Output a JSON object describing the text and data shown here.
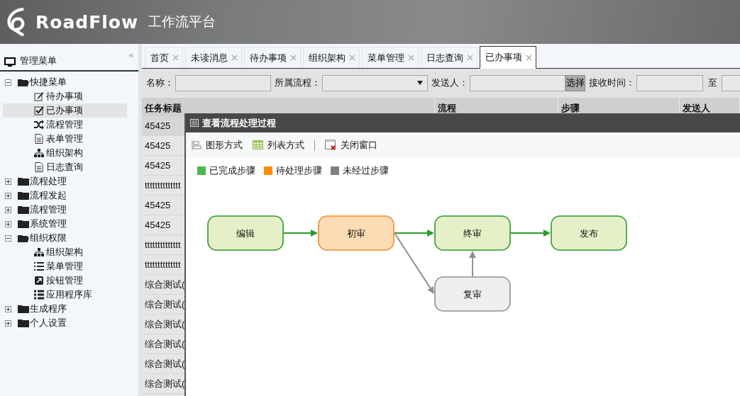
{
  "header": {
    "brand": "RoadFlow",
    "subtitle": "工作流平台"
  },
  "sidebar": {
    "title": "管理菜单",
    "collapse": "«",
    "items": [
      {
        "label": "快捷菜单",
        "expanded": true,
        "children": [
          {
            "label": "待办事项",
            "selected": false
          },
          {
            "label": "已办事项",
            "selected": true
          },
          {
            "label": "流程管理",
            "selected": false
          },
          {
            "label": "表单管理",
            "selected": false
          },
          {
            "label": "组织架构",
            "selected": false
          },
          {
            "label": "日志查询",
            "selected": false
          }
        ]
      },
      {
        "label": "流程处理",
        "expanded": false
      },
      {
        "label": "流程发起",
        "expanded": false
      },
      {
        "label": "流程管理",
        "expanded": false
      },
      {
        "label": "系统管理",
        "expanded": false
      },
      {
        "label": "组织权限",
        "expanded": true,
        "children": [
          {
            "label": "组织架构",
            "selected": false
          },
          {
            "label": "菜单管理",
            "selected": false
          },
          {
            "label": "按钮管理",
            "selected": false
          },
          {
            "label": "应用程序库",
            "selected": false
          }
        ]
      },
      {
        "label": "生成程序",
        "expanded": false
      },
      {
        "label": "个人设置",
        "expanded": false
      }
    ]
  },
  "tabs": [
    {
      "label": "首页",
      "selected": false
    },
    {
      "label": "未读消息",
      "selected": false
    },
    {
      "label": "待办事项",
      "selected": false
    },
    {
      "label": "组织架构",
      "selected": false
    },
    {
      "label": "菜单管理",
      "selected": false
    },
    {
      "label": "日志查询",
      "selected": false
    },
    {
      "label": "已办事项",
      "selected": true
    }
  ],
  "filters": [
    {
      "label": "名称：",
      "kind": "text"
    },
    {
      "label": "所属流程：",
      "kind": "select"
    },
    {
      "label": "发送人：",
      "kind": "picker",
      "button": "选择"
    },
    {
      "label": "接收时间：",
      "kind": "date"
    },
    {
      "label": "至",
      "kind": "date"
    }
  ],
  "table": {
    "columns": [
      "任务标题",
      "流程",
      "步骤",
      "发送人"
    ],
    "rows": [
      {
        "title": "45425",
        "selected": true
      },
      {
        "title": "45425",
        "selected": false
      },
      {
        "title": "45425",
        "selected": false
      },
      {
        "title": "tttttttttttttt",
        "selected": false
      },
      {
        "title": "45425",
        "selected": false
      },
      {
        "title": "45425",
        "selected": false
      },
      {
        "title": "tttttttttttttt",
        "selected": false
      },
      {
        "title": "tttttttttttttt",
        "selected": false
      },
      {
        "title": "综合测试(",
        "selected": false
      },
      {
        "title": "综合测试(",
        "selected": false
      },
      {
        "title": "综合测试(",
        "selected": false
      },
      {
        "title": "综合测试(",
        "selected": false
      },
      {
        "title": "综合测试(",
        "selected": false
      },
      {
        "title": "综合测试(",
        "selected": false
      }
    ]
  },
  "dialog": {
    "title": "查看流程处理过程",
    "toolbar": [
      {
        "label": "图形方式",
        "kind": "graph"
      },
      {
        "label": "列表方式",
        "kind": "list"
      },
      {
        "label": "关闭窗口",
        "kind": "close"
      }
    ],
    "legend": [
      {
        "label": "已完成步骤",
        "color": "#4cb84c"
      },
      {
        "label": "待处理步骤",
        "color": "#ff8c00"
      },
      {
        "label": "未经过步骤",
        "color": "#808080"
      }
    ],
    "nodes": [
      {
        "label": "编辑",
        "kind": "done"
      },
      {
        "label": "初审",
        "kind": "pending"
      },
      {
        "label": "终审",
        "kind": "done"
      },
      {
        "label": "发布",
        "kind": "done"
      },
      {
        "label": "复审",
        "kind": "skipped"
      }
    ],
    "links": [
      {
        "kind": "done"
      },
      {
        "kind": "done"
      },
      {
        "kind": "done"
      },
      {
        "kind": "skipped"
      },
      {
        "kind": "skipped"
      }
    ]
  }
}
